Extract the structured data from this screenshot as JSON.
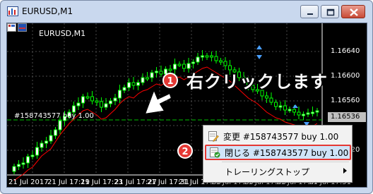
{
  "window": {
    "title": "EURUSD,M1",
    "chart_symbol_label": "EURUSD,M1"
  },
  "axis": {
    "y_labels": [
      "1.16640",
      "1.16600",
      "1.16560",
      "1.16520"
    ],
    "current_price": "1.16536",
    "x_labels": [
      "21 Jul 2017",
      "21 Jul 17:19",
      "21 Jul 17:23",
      "21 Jul 17:27",
      "21 Jul 17:31",
      "21 Jul 17:35",
      "21 Jul 17:39",
      "21 Jul 17:43",
      "21 Jul 17:47",
      "21 Jul 17:51"
    ]
  },
  "order_line": {
    "label": "#158743577 buy 1.00"
  },
  "callouts": {
    "step1_number": "1",
    "step1_text": "右クリックします",
    "step2_number": "2"
  },
  "context_menu": {
    "items": [
      {
        "label": "変更 #158743577 buy 1.00",
        "icon": "modify-order-icon"
      },
      {
        "label": "閉じる #158743577 buy 1.00",
        "icon": "close-order-icon"
      },
      {
        "label": "トレーリングストップ",
        "icon": ""
      }
    ]
  },
  "colors": {
    "chart_background": "#000000",
    "candle_bull": "#ffffff",
    "candle_bear": "#000000",
    "candle_outline": "#00ff00",
    "ma_line": "#ff0000",
    "order_line": "#00c000",
    "highlight": "#e53935"
  }
}
